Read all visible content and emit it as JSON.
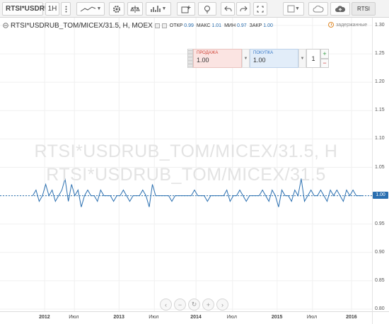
{
  "toolbar": {
    "symbol": "RTSI*USDRUB",
    "interval": "1H",
    "rtsi_button": "RTSI",
    "icons": [
      "more-vert-icon",
      "line-chart-icon",
      "settings-icon",
      "compare-icon",
      "indicators-icon",
      "add-alert-icon",
      "idea-icon",
      "undo-icon",
      "redo-icon",
      "fullscreen-icon",
      "chart-type-icon",
      "cloud-icon",
      "cloud-upload-icon"
    ]
  },
  "legend": {
    "title": "RTSI*USDRUB_TOM/MICEX/31.5, H, MOEX",
    "open_label": "ОТКР",
    "open_value": "0.99",
    "high_label": "МАКС",
    "high_value": "1.01",
    "low_label": "МИН",
    "low_value": "0.97",
    "close_label": "ЗАКР",
    "close_value": "1.00"
  },
  "delayed": "задержанные",
  "watermark": {
    "line1": "RTSI*USDRUB_TOM/MICEX/31.5, H",
    "line2": "RTSI*USDRUB_TOM/MICEX/31.5"
  },
  "trade": {
    "sell_label": "ПРОДАЖА",
    "sell_value": "1.00",
    "buy_label": "ПОКУПКА",
    "buy_value": "1.00",
    "quantity": "1",
    "plus": "+",
    "minus": "−"
  },
  "last_price": "1.00",
  "colors": {
    "line": "#2a6fb0",
    "last_price_bg": "#2a6fb0"
  },
  "chart_data": {
    "type": "line",
    "y_ticks": [
      "1.30",
      "1.25",
      "1.20",
      "1.15",
      "1.10",
      "1.05",
      "1.00",
      "0.95",
      "0.90",
      "0.85",
      "0.80"
    ],
    "ylim": [
      0.795,
      1.31
    ],
    "x_ticks": [
      {
        "label": "2012",
        "pos": 0.12,
        "year": true
      },
      {
        "label": "Июл",
        "pos": 0.2
      },
      {
        "label": "2013",
        "pos": 0.32,
        "year": true
      },
      {
        "label": "Июл",
        "pos": 0.415
      },
      {
        "label": "2014",
        "pos": 0.527,
        "year": true
      },
      {
        "label": "Июл",
        "pos": 0.625
      },
      {
        "label": "2015",
        "pos": 0.745,
        "year": true
      },
      {
        "label": "Июл",
        "pos": 0.84
      },
      {
        "label": "2016",
        "pos": 0.945,
        "year": true
      }
    ],
    "series": [
      {
        "values": [
          1.0,
          1.01,
          0.99,
          1.0,
          1.02,
          1.0,
          1.01,
          0.99,
          1.0,
          1.01,
          1.03,
          0.99,
          1.02,
          1.0,
          1.01,
          0.98,
          1.0,
          1.01,
          1.0,
          1.0,
          0.99,
          1.01,
          1.0,
          1.0,
          1.0,
          0.99,
          1.0,
          1.0,
          1.01,
          1.0,
          0.99,
          1.0,
          1.0,
          1.0,
          1.01,
          1.0,
          0.98,
          1.02,
          1.0,
          1.0,
          1.0,
          1.0,
          1.0,
          0.99,
          1.0,
          1.0,
          1.0,
          1.0,
          1.0,
          1.0,
          1.01,
          1.0,
          1.0,
          1.0,
          0.99,
          1.0,
          1.0,
          1.0,
          1.0,
          1.0,
          1.01,
          0.99,
          1.0,
          1.0,
          1.01,
          1.0,
          0.99,
          1.0,
          1.0,
          1.0,
          1.0,
          1.01,
          1.0,
          0.99,
          1.01,
          1.0,
          0.98,
          1.01,
          1.0,
          1.0,
          0.99,
          1.01,
          1.0,
          1.03,
          0.99,
          1.0,
          1.01,
          1.0,
          1.0,
          1.01,
          1.0,
          0.99,
          1.01,
          1.0,
          1.01,
          1.0,
          0.99,
          1.01,
          1.0,
          1.01,
          1.0,
          1.0,
          1.0
        ]
      }
    ],
    "range": [
      0.088,
      0.975
    ]
  }
}
